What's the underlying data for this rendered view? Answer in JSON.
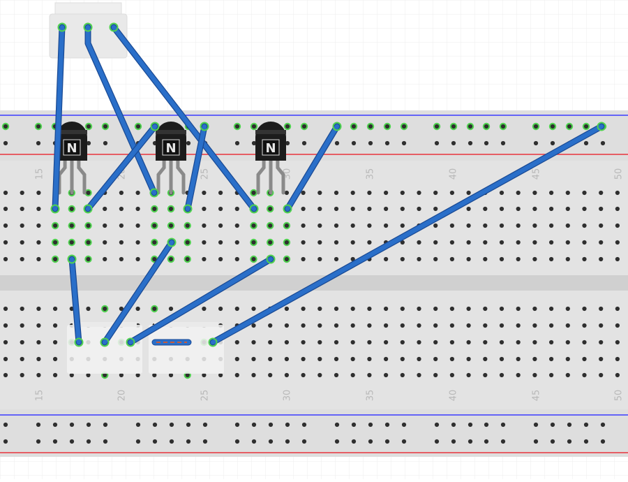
{
  "canvas": {
    "background": "#ffffff",
    "grid_color": "#ececec",
    "board_color": "#dedede",
    "rail_blue": "#3b3bff",
    "rail_red": "#e8343b",
    "hole_color": "#2f2f2f",
    "hole_active_color": "#4fd14f",
    "wire_color": "#2a6fc9",
    "wire_outline": "#1a4a94"
  },
  "breadboard": {
    "column_labels": [
      "15",
      "20",
      "25",
      "30",
      "35",
      "40",
      "45",
      "50"
    ]
  },
  "components": {
    "transistors": [
      {
        "name": "transistor-q1",
        "type": "NPN",
        "mark": "N"
      },
      {
        "name": "transistor-q2",
        "type": "NPN",
        "mark": "N"
      },
      {
        "name": "transistor-q3",
        "type": "NPN",
        "mark": "N"
      }
    ],
    "connector": {
      "name": "three-pin-connector",
      "pins": 3
    },
    "resistor": {
      "name": "resistor"
    },
    "pushbuttons": [
      {
        "name": "pushbutton-1"
      },
      {
        "name": "pushbutton-2"
      }
    ]
  }
}
